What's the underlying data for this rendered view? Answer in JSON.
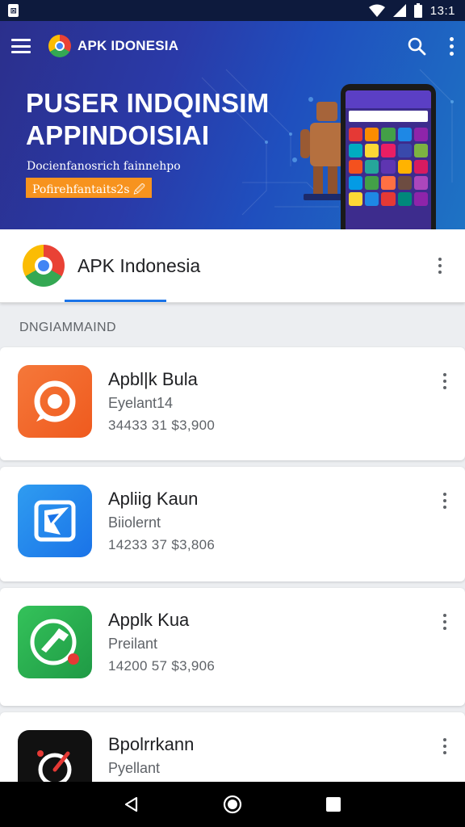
{
  "status_bar": {
    "badge": "🖼",
    "time": "13:1"
  },
  "app_bar": {
    "title": "APK IDONESIA"
  },
  "banner": {
    "title_line1": "PUSER INDQINSIM",
    "title_line2": "APPINDOISIAI",
    "subtitle": "Docienfanosrich fainnehpo",
    "cta_label": "Pofirehfantaits2s 🖉"
  },
  "featured": {
    "title": "APK Indonesia"
  },
  "section": {
    "header": "DNGIAMMAIND"
  },
  "apps": [
    {
      "name": "Apbl|k Bula",
      "developer": "Eyelant14",
      "meta": "34433 31 $3,900",
      "icon": "target-icon",
      "color": "#f26a21"
    },
    {
      "name": "Apliig Kaun",
      "developer": "Biiolernt",
      "meta": "14233 37 $3,806",
      "icon": "arrow-icon",
      "color": "#1e88e5"
    },
    {
      "name": "Applk Kua",
      "developer": "Preilant",
      "meta": "14200 57 $3,906",
      "icon": "hammer-icon",
      "color": "#22a84a"
    },
    {
      "name": "Bpolrrkann",
      "developer": "Pyellant",
      "meta": "",
      "icon": "gauge-icon",
      "color": "#111111"
    }
  ],
  "colors": {
    "status_bar": "#0d1a3d",
    "accent": "#1a73e8",
    "cta": "#f7931e"
  }
}
